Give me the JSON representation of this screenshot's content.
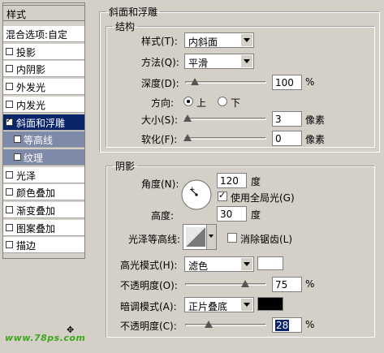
{
  "left_panel": {
    "header": "样式",
    "items": [
      {
        "label": "混合选项:自定",
        "checkbox": false,
        "checked": false
      },
      {
        "label": "投影",
        "checkbox": true,
        "checked": false
      },
      {
        "label": "内阴影",
        "checkbox": true,
        "checked": false
      },
      {
        "label": "外发光",
        "checkbox": true,
        "checked": false
      },
      {
        "label": "内发光",
        "checkbox": true,
        "checked": false
      },
      {
        "label": "斜面和浮雕",
        "checkbox": true,
        "checked": true,
        "selected": true
      },
      {
        "label": "等高线",
        "checkbox": true,
        "checked": false,
        "sub": true
      },
      {
        "label": "纹理",
        "checkbox": true,
        "checked": false,
        "sub": true
      },
      {
        "label": "光泽",
        "checkbox": true,
        "checked": false
      },
      {
        "label": "颜色叠加",
        "checkbox": true,
        "checked": false
      },
      {
        "label": "渐变叠加",
        "checkbox": true,
        "checked": false
      },
      {
        "label": "图案叠加",
        "checkbox": true,
        "checked": false
      },
      {
        "label": "描边",
        "checkbox": true,
        "checked": false
      }
    ],
    "watermark": "www.78ps.com"
  },
  "bevel": {
    "title": "斜面和浮雕",
    "structure": {
      "title": "结构",
      "style_label": "样式(T):",
      "style_value": "内斜面",
      "technique_label": "方法(Q):",
      "technique_value": "平滑",
      "depth_label": "深度(D):",
      "depth_value": "100",
      "depth_unit": "%",
      "depth_level": 0.1,
      "direction_label": "方向:",
      "direction_up": "上",
      "direction_down": "下",
      "size_label": "大小(S):",
      "size_value": "3",
      "size_unit": "像素",
      "size_level": 0.0,
      "soften_label": "软化(F):",
      "soften_value": "0",
      "soften_unit": "像素",
      "soften_level": 0.0
    },
    "shading": {
      "title": "阴影",
      "angle_label": "角度(N):",
      "angle_value": "120",
      "angle_unit": "度",
      "global_light_label": "使用全局光(G)",
      "altitude_label": "高度:",
      "altitude_value": "30",
      "altitude_unit": "度",
      "gloss_label": "光泽等高线:",
      "antialias_label": "消除锯齿(L)",
      "highlight_label": "高光模式(H):",
      "highlight_mode": "滤色",
      "highlight_color": "#ffffff",
      "highlight_opacity_label": "不透明度(O):",
      "highlight_opacity": "75",
      "highlight_opacity_level": 0.75,
      "shadow_label": "暗调模式(A):",
      "shadow_mode": "正片叠底",
      "shadow_color": "#000000",
      "shadow_opacity_label": "不透明度(C):",
      "shadow_opacity": "28",
      "shadow_opacity_level": 0.28,
      "percent": "%"
    }
  }
}
